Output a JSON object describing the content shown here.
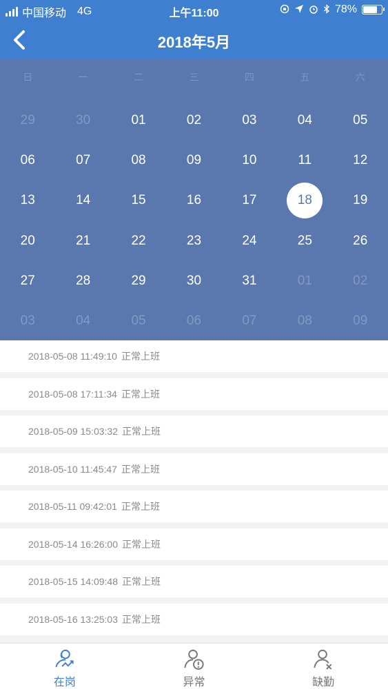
{
  "status_bar": {
    "carrier": "中国移动",
    "network": "4G",
    "time": "上午11:00",
    "battery_percent": "78%",
    "battery_level": 0.78
  },
  "header": {
    "title": "2018年5月",
    "back_icon": "chevron-left-icon"
  },
  "calendar": {
    "weekdays": [
      "日",
      "一",
      "二",
      "三",
      "四",
      "五",
      "六"
    ],
    "weeks": [
      [
        {
          "d": "29",
          "other": true
        },
        {
          "d": "30",
          "other": true
        },
        {
          "d": "01"
        },
        {
          "d": "02"
        },
        {
          "d": "03"
        },
        {
          "d": "04"
        },
        {
          "d": "05"
        }
      ],
      [
        {
          "d": "06"
        },
        {
          "d": "07"
        },
        {
          "d": "08"
        },
        {
          "d": "09"
        },
        {
          "d": "10"
        },
        {
          "d": "11"
        },
        {
          "d": "12"
        }
      ],
      [
        {
          "d": "13"
        },
        {
          "d": "14"
        },
        {
          "d": "15"
        },
        {
          "d": "16"
        },
        {
          "d": "17"
        },
        {
          "d": "18",
          "selected": true
        },
        {
          "d": "19"
        }
      ],
      [
        {
          "d": "20"
        },
        {
          "d": "21"
        },
        {
          "d": "22"
        },
        {
          "d": "23"
        },
        {
          "d": "24"
        },
        {
          "d": "25"
        },
        {
          "d": "26"
        }
      ],
      [
        {
          "d": "27"
        },
        {
          "d": "28"
        },
        {
          "d": "29"
        },
        {
          "d": "30"
        },
        {
          "d": "31"
        },
        {
          "d": "01",
          "other": true
        },
        {
          "d": "02",
          "other": true
        }
      ],
      [
        {
          "d": "03",
          "other": true
        },
        {
          "d": "04",
          "other": true
        },
        {
          "d": "05",
          "other": true
        },
        {
          "d": "06",
          "other": true
        },
        {
          "d": "07",
          "other": true
        },
        {
          "d": "08",
          "other": true
        },
        {
          "d": "09",
          "other": true
        }
      ]
    ]
  },
  "records": [
    {
      "datetime": "2018-05-08 11:49:10",
      "status": "正常上班"
    },
    {
      "datetime": "2018-05-08 17:11:34",
      "status": "正常上班"
    },
    {
      "datetime": "2018-05-09 15:03:32",
      "status": "正常上班"
    },
    {
      "datetime": "2018-05-10 11:45:47",
      "status": "正常上班"
    },
    {
      "datetime": "2018-05-11 09:42:01",
      "status": "正常上班"
    },
    {
      "datetime": "2018-05-14 16:26:00",
      "status": "正常上班"
    },
    {
      "datetime": "2018-05-15 14:09:48",
      "status": "正常上班"
    },
    {
      "datetime": "2018-05-16 13:25:03",
      "status": "正常上班"
    }
  ],
  "tabs": [
    {
      "label": "在岗",
      "icon": "on-duty-icon",
      "active": true
    },
    {
      "label": "异常",
      "icon": "abnormal-icon",
      "active": false
    },
    {
      "label": "缺勤",
      "icon": "absent-icon",
      "active": false
    }
  ],
  "colors": {
    "primary": "#3f7fd0",
    "calendar_bg": "#5a78ae",
    "inactive": "#777777"
  }
}
